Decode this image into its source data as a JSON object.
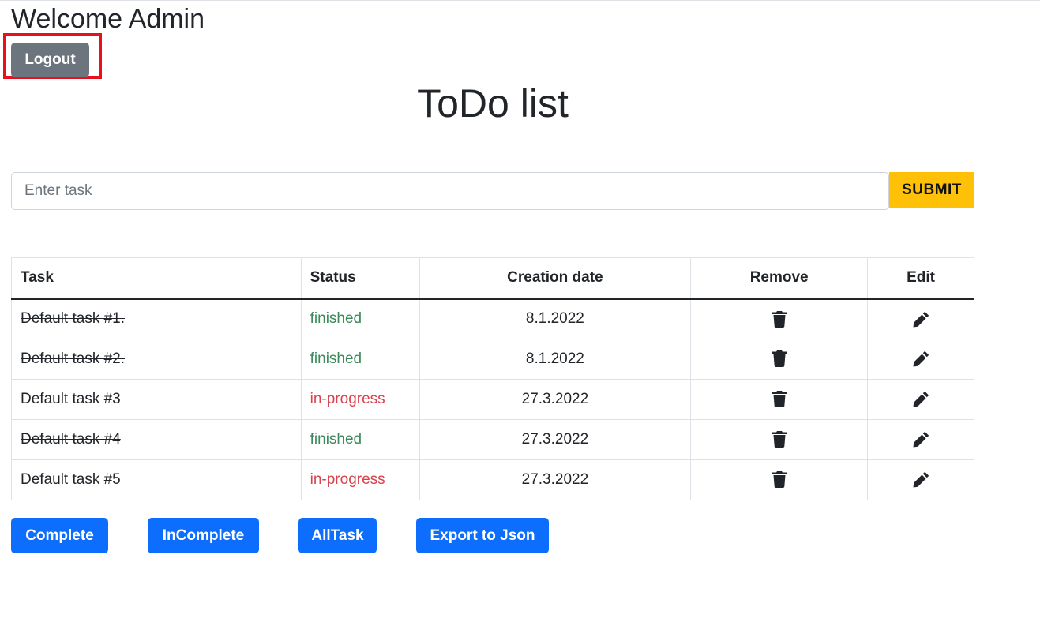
{
  "header": {
    "welcome_text": "Welcome Admin",
    "logout_label": "Logout"
  },
  "title": "ToDo list",
  "task_form": {
    "input_value": "",
    "input_placeholder": "Enter task",
    "submit_label": "SUBMIT"
  },
  "table": {
    "columns": [
      "Task",
      "Status",
      "Creation date",
      "Remove",
      "Edit"
    ],
    "rows": [
      {
        "task": "Default task #1.",
        "status": "finished",
        "date": "8.1.2022",
        "done": true
      },
      {
        "task": "Default task #2.",
        "status": "finished",
        "date": "8.1.2022",
        "done": true
      },
      {
        "task": "Default task #3",
        "status": "in-progress",
        "date": "27.3.2022",
        "done": false
      },
      {
        "task": "Default task #4",
        "status": "finished",
        "date": "27.3.2022",
        "done": true
      },
      {
        "task": "Default task #5",
        "status": "in-progress",
        "date": "27.3.2022",
        "done": false
      }
    ],
    "remove_icon": "trash-icon",
    "edit_icon": "pencil-icon"
  },
  "filters": {
    "complete_label": "Complete",
    "incomplete_label": "InComplete",
    "alltask_label": "AllTask",
    "export_label": "Export to Json"
  },
  "colors": {
    "finished": "#3a8a5a",
    "in_progress": "#d9434f",
    "primary": "#0d6efd",
    "warning": "#ffc107",
    "secondary": "#6c757d",
    "highlight": "#e8101d"
  }
}
